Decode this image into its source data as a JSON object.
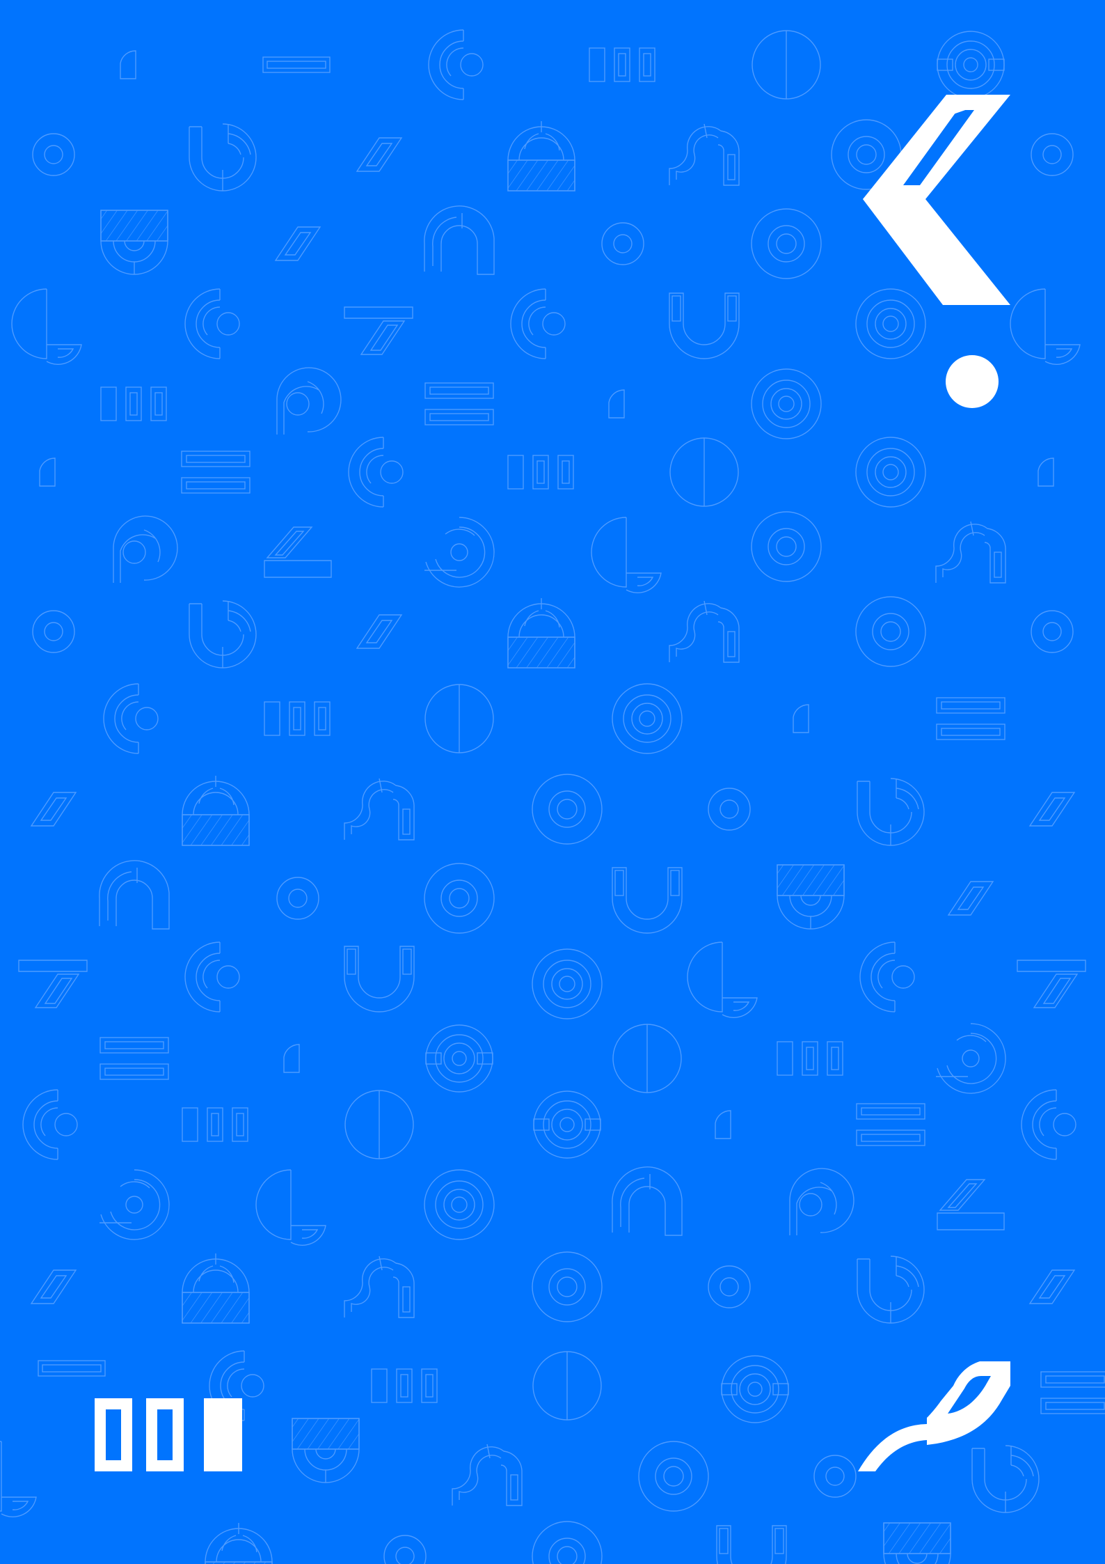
{
  "colors": {
    "background": "#0174FE",
    "pattern_stroke": "#4E9BFF",
    "emblem_fill": "#FFFFFF"
  },
  "icons": {
    "background_pattern": "geometric-glyph-pattern",
    "top_right": "chevron-exclamation-logo",
    "bottom_left": "three-bars-logo",
    "bottom_right": "wave-hook-logo"
  }
}
